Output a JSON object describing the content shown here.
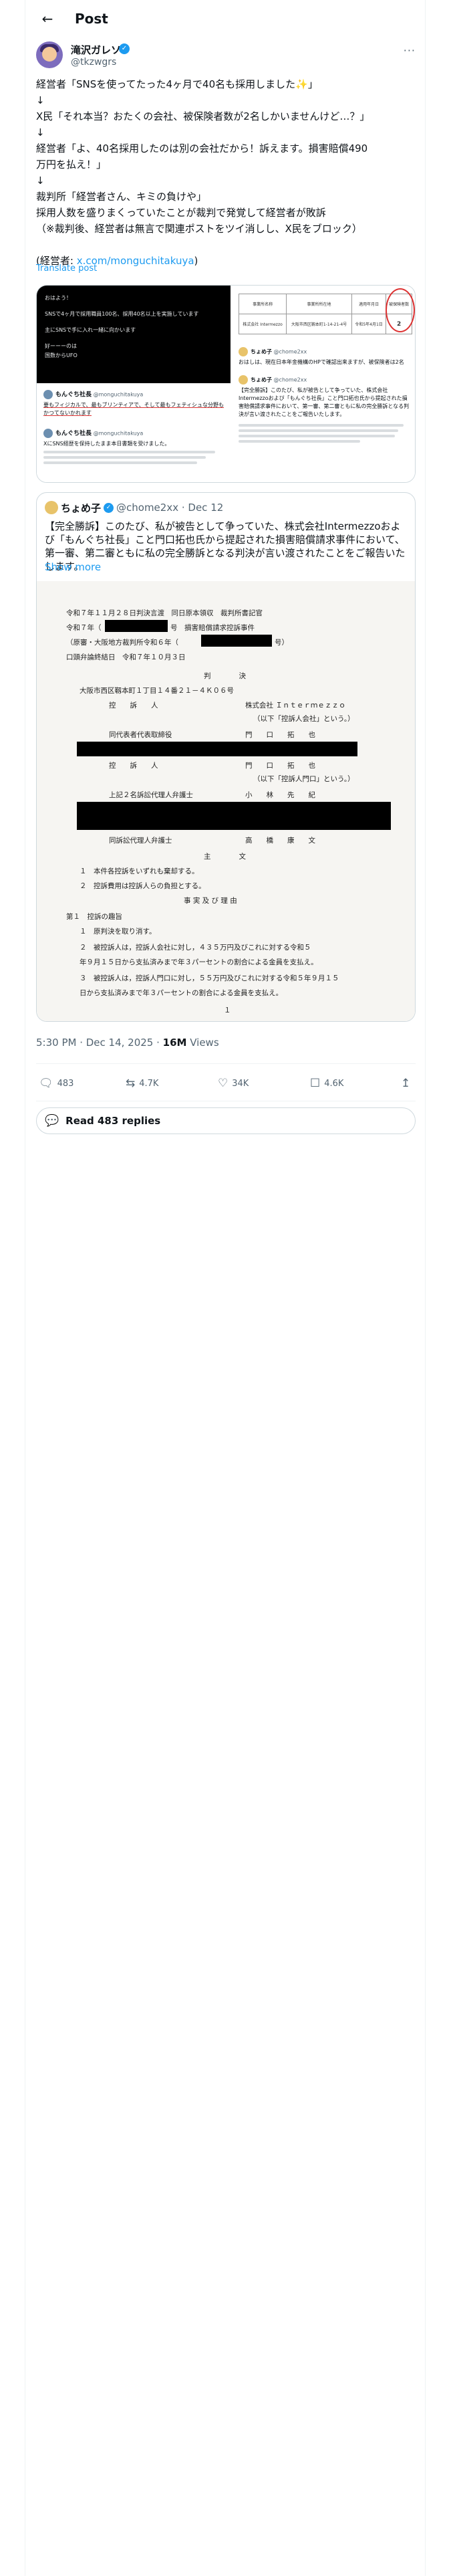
{
  "header": {
    "title": "Post",
    "back_icon": "arrow-left-icon"
  },
  "author": {
    "display_name": "滝沢ガレソ",
    "handle": "@tkzwgrs",
    "verified": true
  },
  "tweet": {
    "lines": [
      "経営者「SNSを使ってたった4ヶ月で40名も採用しました✨」",
      "↓",
      "X民「それ本当？おたくの会社、被保険者数が2名しかいませんけど…？」",
      "↓",
      "経営者「よ、40名採用したのは別の会社だから！訴えます。損害賠償490",
      "万円を払え！」",
      "↓",
      "裁判所「経営者さん、キミの負けや」",
      "採用人数を盛りまくっていたことが裁判で発覚して経営者が敗訴",
      "（※裁判後、経営者は無言で関連ポストをツイ消しし、X民をブロック）",
      "",
      "(経営者: "
    ],
    "link_text": "x.com/monguchitakuya",
    "link_suffix": ")",
    "translate": "Translate post"
  },
  "media": {
    "left_dark_lines": [
      "おはよう！",
      "SNSで4ヶ月で採用職員100名、採用40名以上を実施しています",
      "主にSNSで手に入れ一緒に向かいます",
      "好ーーーのは",
      "国数からUFO"
    ],
    "left_tweet1_name": "もんぐち社長",
    "left_tweet1_handle": "@monguchitakuya",
    "left_tweet1_text": "要もフィジカルで、最もブリンティアで、そして最もフェティシュな分野もかつてないかれます",
    "left_tweet2_name": "もんぐち社長",
    "left_tweet2_handle": "@monguchitakuya",
    "left_tweet2_text": "XにSNS経歴を保持したまま本日書類を受けました。",
    "right_headers": [
      "事業所名称",
      "事業所所在地",
      "適用年月日",
      "被保険者数"
    ],
    "right_row": [
      "株式会社 Intermezzo",
      "大阪市西区靱本町1-14-21-4号",
      "令和5年4月1日",
      "2"
    ],
    "right_tweet1_name": "ちょめ子",
    "right_tweet1_handle": "@chome2xx",
    "right_tweet1_text": "おはしは、現在日本年金機構のHPで確認出来ますが、被保険者は2名",
    "right_tweet2_name": "ちょめ子",
    "right_tweet2_handle": "@chome2xx",
    "right_tweet2_text": "【完全勝訴】このたび、私が被告として争っていた、株式会社Intermezzoおよび「もんぐち社長」こと門口拓也氏から提起された損害賠償請求事件において、第一審、第二審ともに私の完全勝訴となる判決が言い渡されたことをご報告いたします。"
  },
  "quote": {
    "name": "ちょめ子",
    "handle": "@chome2xx",
    "date": "Dec 12",
    "text": "【完全勝訴】このたび、私が被告として争っていた、株式会社Intermezzoおよび「もんぐち社長」こと門口拓也氏から提起された損害賠償請求事件において、第一審、第二審ともに私の完全勝訴となる判決が言い渡されたことをご報告いたします。",
    "show_more": "Show more",
    "doc": {
      "l1": "令和７年１１月２８日判決言渡　同日原本領収　裁判所書記官",
      "l2a": "令和７年（",
      "l2b": "号　損害賠償請求控訴事件",
      "l3a": "（原審・大阪地方裁判所令和６年（",
      "l3b": "号）",
      "l4": "口頭弁論終結日　令和７年１０月３日",
      "l5": "判　　　　決",
      "l6": "大阪市西区靱本町１丁目１４番２１－４Ｋ０６号",
      "l7a": "控　　訴　　人",
      "l7b": "株式会社 Ｉｎｔｅｒｍｅｚｚｏ",
      "l8": "（以下「控訴人会社」という。）",
      "l9a": "同代表者代表取締役",
      "l9b": "門　　口　　拓　　也",
      "l10a": "控　　訴　　人",
      "l10b": "門　　口　　拓　　也",
      "l11": "（以下「控訴人門口」という。）",
      "l12a": "上記２名訴訟代理人弁護士",
      "l12b": "小　　林　　先　　紀",
      "l13a": "同訴訟代理人弁護士",
      "l13b": "高　　橋　　康　　文",
      "l14": "主　　　　文",
      "l15": "１　本件各控訴をいずれも棄却する。",
      "l16": "２　控訴費用は控訴人らの負担とする。",
      "l17": "事 実 及 び 理 由",
      "l18": "第１　控訴の趣旨",
      "l19": "１　原判決を取り消す。",
      "l20": "２　被控訴人は，控訴人会社に対し，４３５万円及びこれに対する令和５",
      "l21": "年９月１５日から支払済みまで年３パーセントの割合による金員を支払え。",
      "l22": "３　被控訴人は，控訴人門口に対し，５５万円及びこれに対する令和５年９月１５",
      "l23": "日から支払済みまで年３パーセントの割合による金員を支払え。",
      "page": "１"
    }
  },
  "footer": {
    "time": "5:30 PM · Dec 14, 2025 · ",
    "views_count": "16M",
    "views_label": " Views",
    "replies": "483",
    "reposts": "4.7K",
    "likes": "34K",
    "bookmarks": "4.6K",
    "read_replies": "Read 483 replies"
  }
}
